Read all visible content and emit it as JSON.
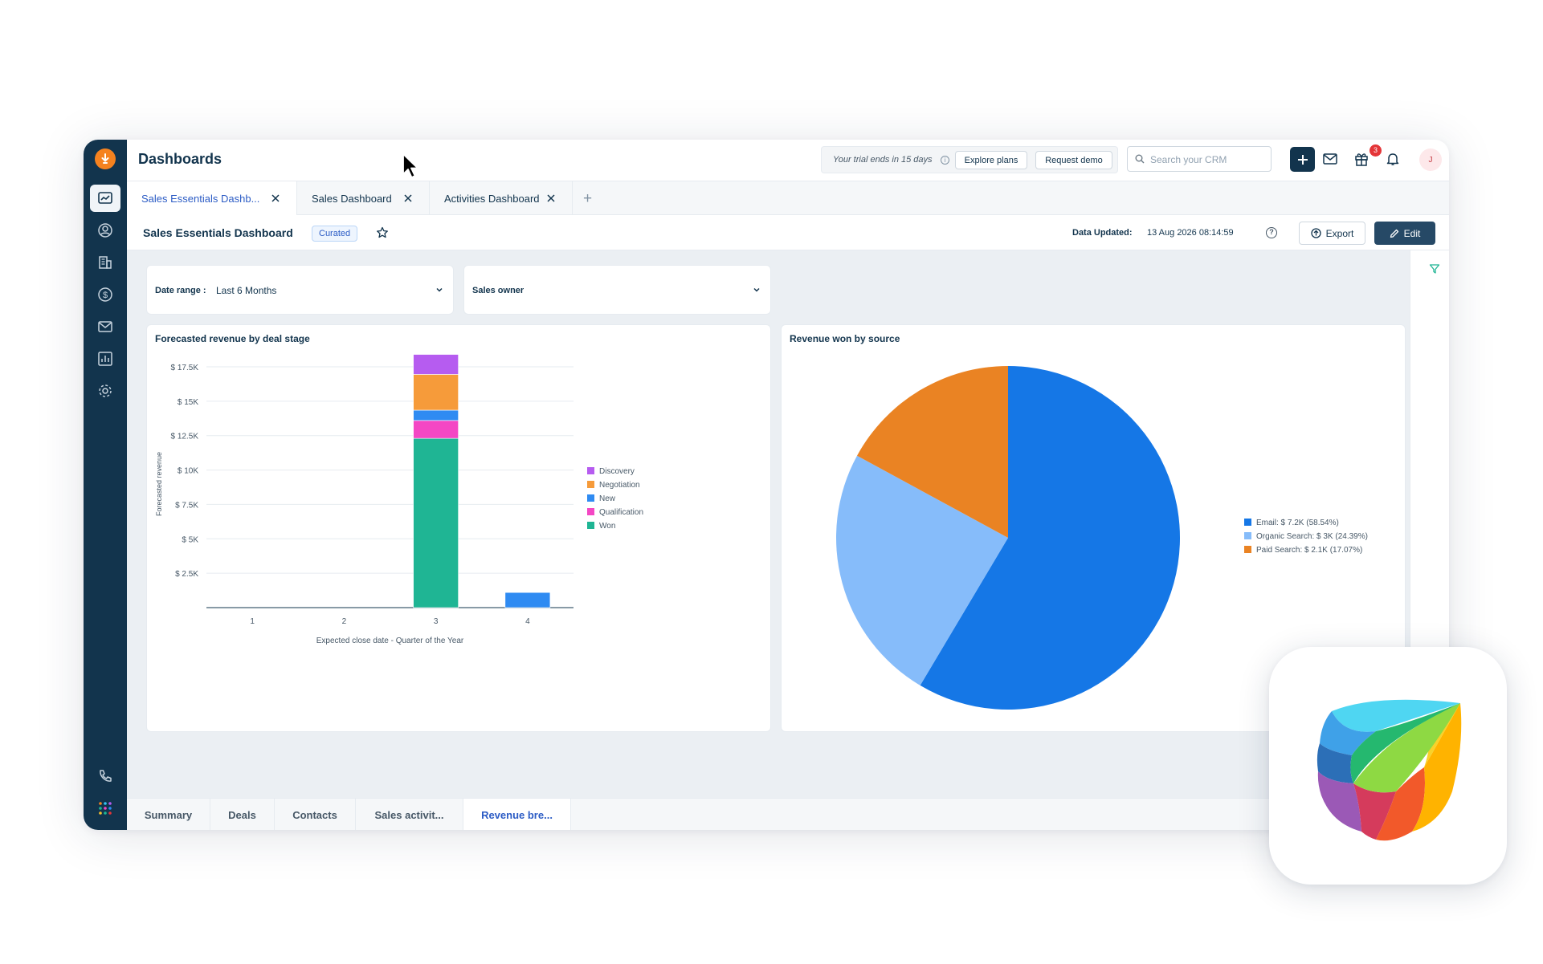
{
  "app": {
    "title": "Dashboards",
    "trial_text": "Your trial ends in 15 days",
    "explore_plans": "Explore plans",
    "request_demo": "Request demo",
    "search_placeholder": "Search your CRM",
    "notification_count": "3",
    "avatar_initial": "J"
  },
  "tabs": [
    {
      "label": "Sales Essentials Dashb...",
      "active": true
    },
    {
      "label": "Sales Dashboard",
      "active": false
    },
    {
      "label": "Activities Dashboard",
      "active": false
    }
  ],
  "dashboard": {
    "name": "Sales Essentials Dashboard",
    "badge": "Curated",
    "updated_label": "Data Updated:",
    "updated_value": "13 Aug 2026 08:14:59",
    "export_label": "Export",
    "edit_label": "Edit"
  },
  "filters": {
    "date_range_label": "Date range :",
    "date_range_value": "Last 6 Months",
    "sales_owner_label": "Sales owner"
  },
  "bottom_tabs": [
    {
      "label": "Summary",
      "active": false
    },
    {
      "label": "Deals",
      "active": false
    },
    {
      "label": "Contacts",
      "active": false
    },
    {
      "label": "Sales activit...",
      "active": false
    },
    {
      "label": "Revenue bre...",
      "active": true
    }
  ],
  "colors": {
    "sidebar": "#12344d",
    "accent": "#2c5cc5",
    "brand_orange": "#f5821f"
  },
  "chart_data": [
    {
      "type": "bar",
      "stacked": true,
      "title": "Forecasted revenue by deal stage",
      "xlabel": "Expected close date - Quarter of the Year",
      "ylabel": "Forecasted revenue",
      "categories": [
        "1",
        "2",
        "3",
        "4"
      ],
      "ylim": [
        0,
        17500
      ],
      "yticks": [
        2500,
        5000,
        7500,
        10000,
        12500,
        15000,
        17500
      ],
      "ytick_labels": [
        "$ 2.5K",
        "$ 5K",
        "$ 7.5K",
        "$ 10K",
        "$ 12.5K",
        "$ 15K",
        "$ 17.5K"
      ],
      "grid": true,
      "legend_position": "right",
      "series": [
        {
          "name": "Won",
          "color": "#1fb594",
          "values": [
            0,
            0,
            12300,
            0
          ]
        },
        {
          "name": "Qualification",
          "color": "#f447c4",
          "values": [
            0,
            0,
            1300,
            0
          ]
        },
        {
          "name": "New",
          "color": "#2f8bf2",
          "values": [
            0,
            0,
            750,
            1100
          ]
        },
        {
          "name": "Negotiation",
          "color": "#f69b3a",
          "values": [
            0,
            0,
            2600,
            0
          ]
        },
        {
          "name": "Discovery",
          "color": "#b65cf0",
          "values": [
            0,
            0,
            1450,
            0
          ]
        }
      ],
      "legend_order": [
        "Discovery",
        "Negotiation",
        "New",
        "Qualification",
        "Won"
      ]
    },
    {
      "type": "pie",
      "title": "Revenue won by source",
      "legend_position": "right",
      "slices": [
        {
          "label": "Email: $ 7.2K (58.54%)",
          "value": 58.54,
          "color": "#1577e6"
        },
        {
          "label": "Organic Search: $ 3K (24.39%)",
          "value": 24.39,
          "color": "#86bcfa"
        },
        {
          "label": "Paid Search: $ 2.1K (17.07%)",
          "value": 17.07,
          "color": "#ea8323"
        }
      ]
    }
  ]
}
